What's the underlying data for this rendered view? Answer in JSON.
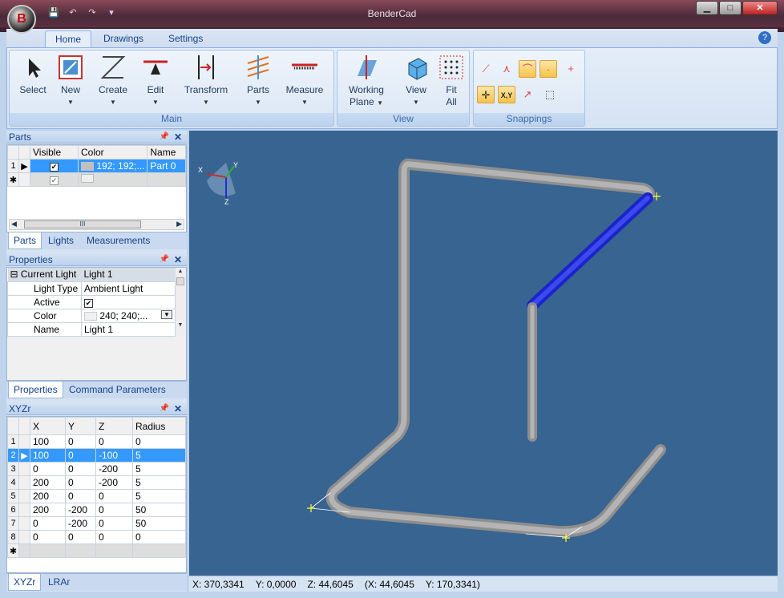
{
  "window": {
    "title": "BenderCad",
    "min": "▁",
    "max": "□",
    "close": "✕"
  },
  "app_button": "B",
  "qat": {
    "save": "💾",
    "undo": "↶",
    "redo": "↷",
    "dropdown": "▾"
  },
  "tabs": [
    "Home",
    "Drawings",
    "Settings"
  ],
  "help": "?",
  "ribbon": {
    "main": {
      "label": "Main",
      "buttons": [
        "Select",
        "New",
        "Create",
        "Edit",
        "Transform",
        "Parts",
        "Measure"
      ]
    },
    "view": {
      "label": "View",
      "working_plane_1": "Working",
      "working_plane_2": "Plane",
      "view": "View",
      "fit_1": "Fit",
      "fit_2": "All"
    },
    "snappings": {
      "label": "Snappings",
      "xy": "X,Y"
    }
  },
  "parts_pane": {
    "title": "Parts",
    "headers": [
      "Visible",
      "Color",
      "Name"
    ],
    "rows": [
      {
        "num": "1",
        "color": "192; 192;...",
        "name": "Part 0"
      }
    ],
    "new_row": "✱",
    "scroll": "III",
    "tabs": [
      "Parts",
      "Lights",
      "Measurements"
    ]
  },
  "properties_pane": {
    "title": "Properties",
    "category": "Current Light",
    "category_value": "Light 1",
    "rows": [
      {
        "name": "Light Type",
        "value": "Ambient Light"
      },
      {
        "name": "Active",
        "value": ""
      },
      {
        "name": "Color",
        "value": "240;  240;..."
      },
      {
        "name": "Name",
        "value": "Light 1"
      }
    ],
    "tabs": [
      "Properties",
      "Command Parameters"
    ]
  },
  "xyz_pane": {
    "title": "XYZr",
    "headers": [
      "X",
      "Y",
      "Z",
      "Radius"
    ],
    "rows": [
      [
        "1",
        "100",
        "0",
        "0",
        "0"
      ],
      [
        "2",
        "100",
        "0",
        "-100",
        "5"
      ],
      [
        "3",
        "0",
        "0",
        "-200",
        "5"
      ],
      [
        "4",
        "200",
        "0",
        "-200",
        "5"
      ],
      [
        "5",
        "200",
        "0",
        "0",
        "5"
      ],
      [
        "6",
        "200",
        "-200",
        "0",
        "50"
      ],
      [
        "7",
        "0",
        "-200",
        "0",
        "50"
      ],
      [
        "8",
        "0",
        "0",
        "0",
        "0"
      ]
    ],
    "new_row": "✱",
    "tabs": [
      "XYZr",
      "LRAr"
    ]
  },
  "axes": {
    "x": "X",
    "y": "Y",
    "z": "Z"
  },
  "status": [
    "X: 370,3341",
    "Y: 0,0000",
    "Z: 44,6045",
    "(X: 44,6045",
    "Y: 170,3341)"
  ]
}
